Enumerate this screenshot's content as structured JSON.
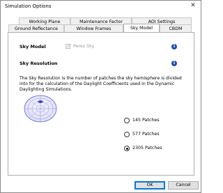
{
  "window": {
    "title": "Simulation Options",
    "close_glyph": "✕"
  },
  "tabs": {
    "row1": [
      "Working Plane",
      "Maintenance Factor",
      "AOI Settings"
    ],
    "row2": [
      "Ground Reflectance",
      "Window Frames",
      "Sky Model",
      "CBDM"
    ],
    "active": "Sky Model"
  },
  "sky_model": {
    "heading": "Sky Model",
    "perez_label": "Perez Sky",
    "perez_checked": true,
    "perez_enabled": false,
    "info_glyph": "i"
  },
  "sky_resolution": {
    "heading": "Sky Resolution",
    "description": "The Sky Resolution is the number of patches the sky hemisphere is divided into for the calculation of the Daylight Coefficients used in the Dynamic Daylighting Simulations.",
    "options": [
      {
        "label": "145 Patches",
        "checked": false
      },
      {
        "label": "577 Patches",
        "checked": false
      },
      {
        "label": "2305 Patches",
        "checked": true
      }
    ],
    "dome_color": "#5a5ad0"
  },
  "buttons": {
    "ok": "OK",
    "cancel": "Cancel"
  },
  "colors": {
    "accent": "#0078d7",
    "info": "#1b4fb0"
  }
}
